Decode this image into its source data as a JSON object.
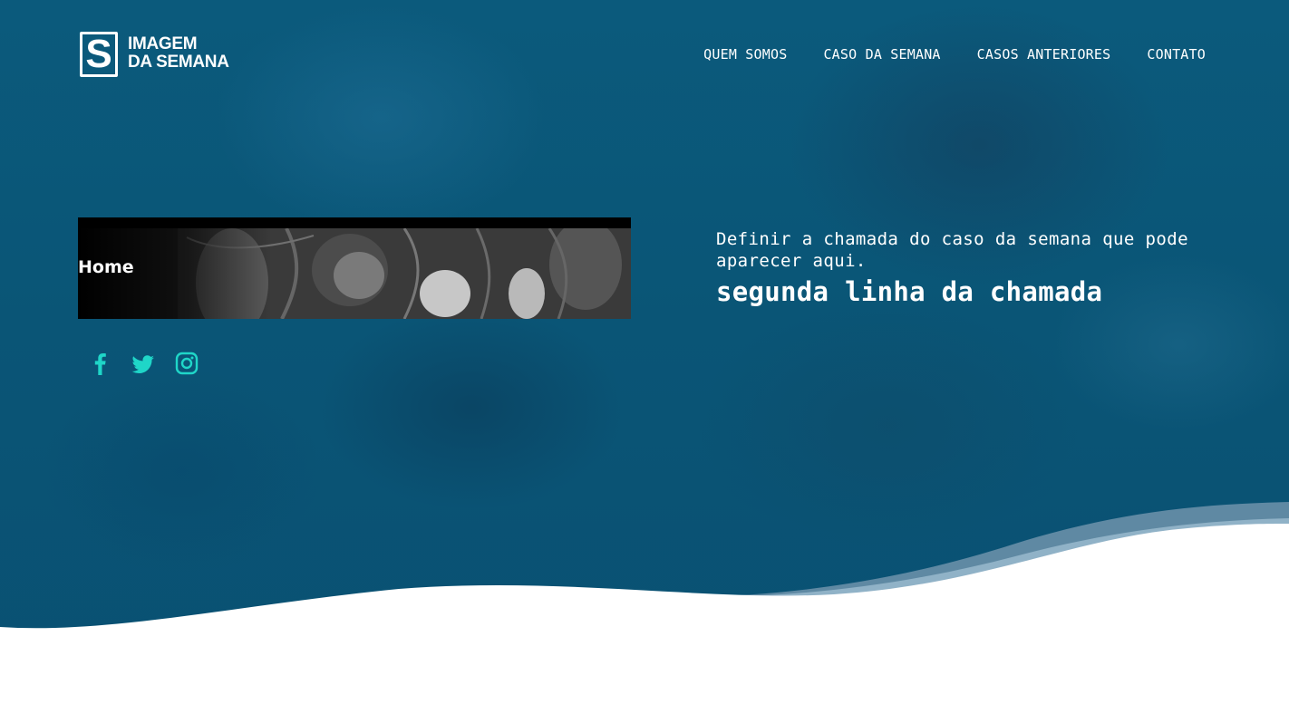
{
  "brand": {
    "mark": "S",
    "line1": "IMAGEM",
    "line2": "DA SEMANA"
  },
  "nav": {
    "items": [
      {
        "label": "QUEM SOMOS"
      },
      {
        "label": "CASO DA SEMANA"
      },
      {
        "label": "CASOS ANTERIORES"
      },
      {
        "label": "CONTATO"
      }
    ]
  },
  "banner": {
    "label": "Home"
  },
  "social": {
    "icons": [
      "facebook-icon",
      "twitter-icon",
      "instagram-icon"
    ],
    "color": "#1fd6c8"
  },
  "headline": {
    "line1": "Definir a chamada do caso da semana que pode aparecer aqui.",
    "line2": "segunda linha da chamada"
  },
  "colors": {
    "hero_background": "#0a5576",
    "text": "#ffffff",
    "accent": "#1fd6c8"
  }
}
